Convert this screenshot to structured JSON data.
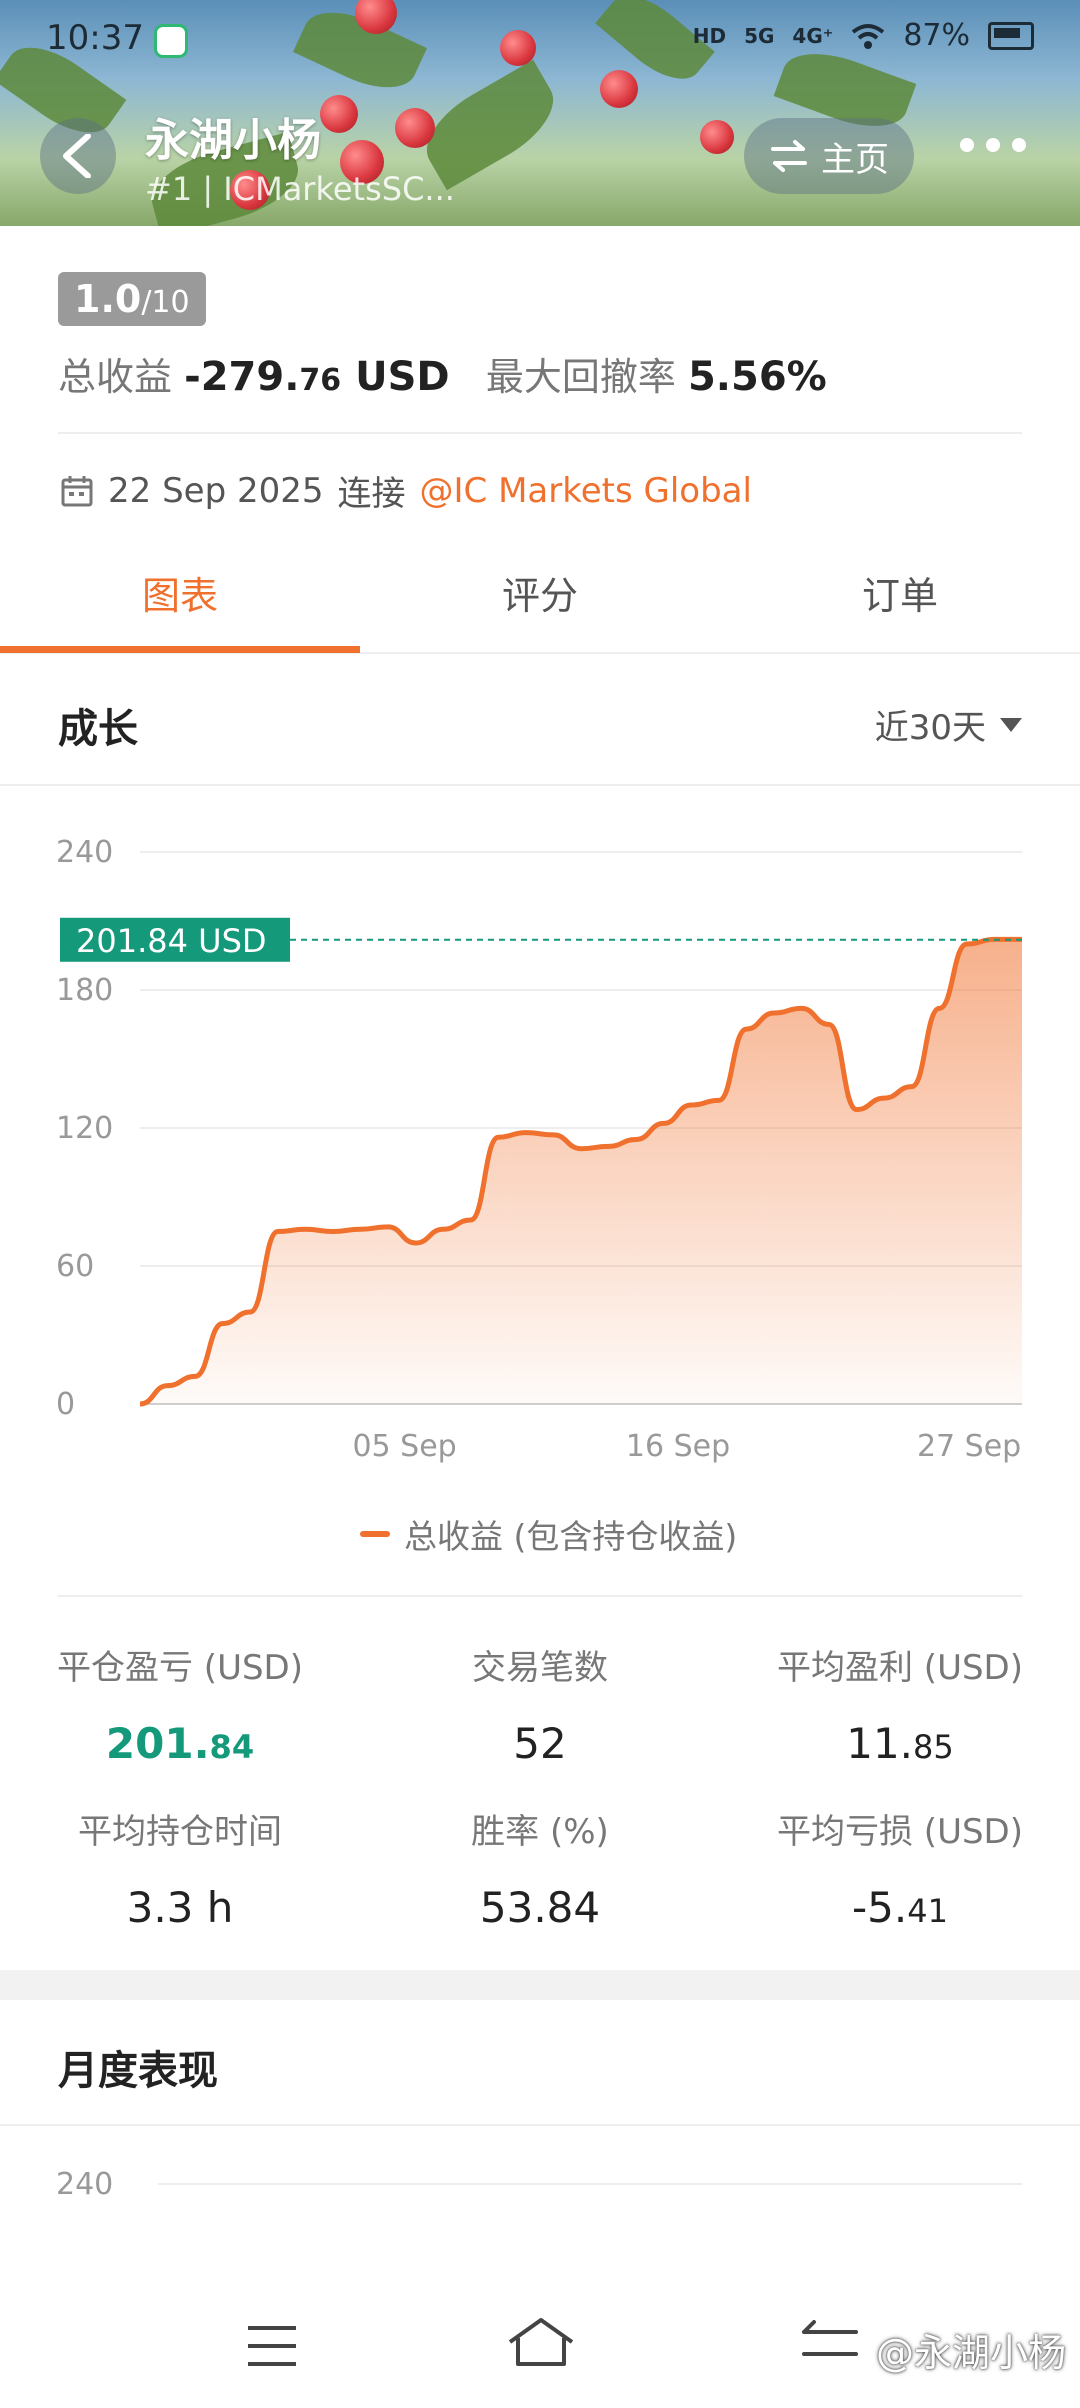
{
  "status_bar": {
    "time": "10:37",
    "battery": "87%",
    "network_1": "5G",
    "network_2": "4G⁺",
    "hd_label": "HD"
  },
  "header": {
    "title": "永湖小杨",
    "subtitle": "#1 | ICMarketsSC...",
    "home_label": "主页"
  },
  "summary": {
    "score_main": "1.0",
    "score_total": "/10",
    "total_profit_label": "总收益",
    "total_profit_int": "-279.",
    "total_profit_dec": "76",
    "total_profit_unit": "USD",
    "max_drawdown_label": "最大回撤率",
    "max_drawdown_value": "5.56%"
  },
  "connection": {
    "date": "22 Sep 2025",
    "connect_label": "连接",
    "broker": "@IC Markets Global"
  },
  "tabs": [
    {
      "label": "图表"
    },
    {
      "label": "评分"
    },
    {
      "label": "订单"
    }
  ],
  "growth": {
    "title": "成长",
    "period": "近30天"
  },
  "chart_data": {
    "type": "area",
    "series": [
      {
        "name": "总收益 (包含持仓收益)",
        "values": [
          0,
          8,
          12,
          35,
          40,
          75,
          76,
          75,
          76,
          77,
          70,
          76,
          80,
          116,
          118,
          117,
          111,
          112,
          115,
          122,
          130,
          132,
          163,
          170,
          172,
          165,
          128,
          133,
          138,
          172,
          200,
          202,
          202
        ]
      }
    ],
    "x_tick_labels": [
      "05 Sep",
      "16 Sep",
      "27 Sep"
    ],
    "y_ticks": [
      0,
      60,
      120,
      180,
      240
    ],
    "ylim": [
      0,
      240
    ],
    "current_value_label": "201.84 USD",
    "current_value": 201.84,
    "grid": true,
    "legend_position": "bottom",
    "colors": {
      "line": "#f0702d",
      "fill": "#f0702d",
      "marker": "#14997a"
    }
  },
  "stats": {
    "closed_pnl_label": "平仓盈亏 (USD)",
    "closed_pnl_int": "201.",
    "closed_pnl_dec": "84",
    "trades_label": "交易笔数",
    "trades_value": "52",
    "avg_profit_label": "平均盈利 (USD)",
    "avg_profit_int": "11.",
    "avg_profit_dec": "85",
    "avg_hold_label": "平均持仓时间",
    "avg_hold_value": "3.3 h",
    "win_rate_label": "胜率 (%)",
    "win_rate_value": "53.84",
    "avg_loss_label": "平均亏损 (USD)",
    "avg_loss_int": "-5.",
    "avg_loss_dec": "41"
  },
  "monthly": {
    "title": "月度表现",
    "first_tick": "240"
  },
  "watermark": "@永湖小杨"
}
